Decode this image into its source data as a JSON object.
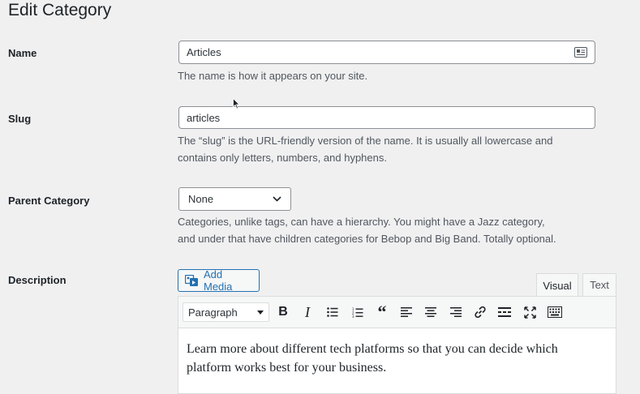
{
  "page": {
    "title": "Edit Category"
  },
  "fields": {
    "name": {
      "label": "Name",
      "value": "Articles",
      "help": "The name is how it appears on your site."
    },
    "slug": {
      "label": "Slug",
      "value": "articles",
      "help_line1": "The “slug” is the URL-friendly version of the name. It is usually all lowercase and",
      "help_line2": "contains only letters, numbers, and hyphens."
    },
    "parent": {
      "label": "Parent Category",
      "selected": "None",
      "help_line1": "Categories, unlike tags, can have a hierarchy. You might have a Jazz category,",
      "help_line2": "and under that have children categories for Bebop and Big Band. Totally optional."
    },
    "description": {
      "label": "Description",
      "add_media": "Add Media",
      "tabs": [
        "Visual",
        "Text"
      ],
      "format_selected": "Paragraph",
      "content_line1": "Learn more about different tech platforms so that you can decide which",
      "content_line2": "platform works best for your business."
    }
  },
  "colors": {
    "accent": "#2271b1",
    "background": "#f0f0f1"
  }
}
